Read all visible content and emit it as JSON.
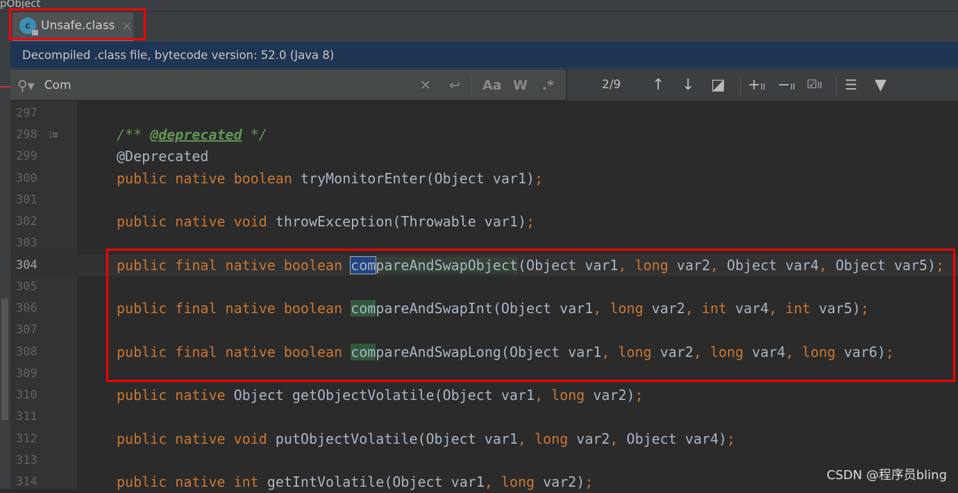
{
  "topbar": {
    "title": "pObject"
  },
  "tab": {
    "label": "Unsafe.class",
    "icon": "class-file-icon",
    "close": "×"
  },
  "banner": {
    "text": "Decompiled .class file, bytecode version: 52.0 (Java 8)"
  },
  "search": {
    "value": "Com",
    "count": "2/9",
    "icons": [
      "search-icon",
      "clear-icon",
      "new-line-icon",
      "match-case-icon",
      "words-icon",
      "regex-icon",
      "prev-occurrence-icon",
      "next-occurrence-icon",
      "select-all-icon",
      "add-selection-icon",
      "remove-selection-icon",
      "select-all-occurrences-icon",
      "filter-search-icon",
      "filter-icon"
    ],
    "labels": {
      "clear": "✕",
      "newline": "↩",
      "case": "Aa",
      "words": "W",
      "regex": ".*",
      "up": "↑",
      "down": "↓"
    }
  },
  "editor": {
    "caret_line": "304",
    "lines": [
      {
        "n": "297",
        "tokens": []
      },
      {
        "n": "298",
        "fold": true,
        "tokens": [
          {
            "c": "cm",
            "v": "/** "
          },
          {
            "c": "tag",
            "v": "@deprecated"
          },
          {
            "c": "cm",
            "v": " */"
          }
        ]
      },
      {
        "n": "299",
        "tokens": [
          {
            "c": "id",
            "v": "@Deprecated"
          }
        ]
      },
      {
        "n": "300",
        "tokens": [
          {
            "c": "kw",
            "v": "public native boolean "
          },
          {
            "c": "id",
            "v": "tryMonitorEnter(Object var1)"
          },
          {
            "c": "kw",
            "v": ";"
          }
        ]
      },
      {
        "n": "301",
        "tokens": []
      },
      {
        "n": "302",
        "tokens": [
          {
            "c": "kw",
            "v": "public native void "
          },
          {
            "c": "id",
            "v": "throwException(Throwable var1)"
          },
          {
            "c": "kw",
            "v": ";"
          }
        ]
      },
      {
        "n": "303",
        "tokens": []
      },
      {
        "n": "304",
        "tokens": [
          {
            "c": "kw",
            "v": "public final native boolean "
          },
          {
            "c": "cur",
            "v": "com"
          },
          {
            "c": "word",
            "v": "pareAndSwapObject"
          },
          {
            "c": "id",
            "v": "(Object var1"
          },
          {
            "c": "kw",
            "v": ", long "
          },
          {
            "c": "id",
            "v": "var2"
          },
          {
            "c": "kw",
            "v": ", "
          },
          {
            "c": "id",
            "v": "Object var4"
          },
          {
            "c": "kw",
            "v": ", "
          },
          {
            "c": "id",
            "v": "Object var5)"
          },
          {
            "c": "kw",
            "v": ";"
          }
        ]
      },
      {
        "n": "305",
        "tokens": []
      },
      {
        "n": "306",
        "tokens": [
          {
            "c": "kw",
            "v": "public final native boolean "
          },
          {
            "c": "match",
            "v": "com"
          },
          {
            "c": "id",
            "v": "pareAndSwapInt(Object var1"
          },
          {
            "c": "kw",
            "v": ", long "
          },
          {
            "c": "id",
            "v": "var2"
          },
          {
            "c": "kw",
            "v": ", int "
          },
          {
            "c": "id",
            "v": "var4"
          },
          {
            "c": "kw",
            "v": ", int "
          },
          {
            "c": "id",
            "v": "var5)"
          },
          {
            "c": "kw",
            "v": ";"
          }
        ]
      },
      {
        "n": "307",
        "tokens": []
      },
      {
        "n": "308",
        "tokens": [
          {
            "c": "kw",
            "v": "public final native boolean "
          },
          {
            "c": "match",
            "v": "com"
          },
          {
            "c": "id",
            "v": "pareAndSwapLong(Object var1"
          },
          {
            "c": "kw",
            "v": ", long "
          },
          {
            "c": "id",
            "v": "var2"
          },
          {
            "c": "kw",
            "v": ", long "
          },
          {
            "c": "id",
            "v": "var4"
          },
          {
            "c": "kw",
            "v": ", long "
          },
          {
            "c": "id",
            "v": "var6)"
          },
          {
            "c": "kw",
            "v": ";"
          }
        ]
      },
      {
        "n": "309",
        "tokens": []
      },
      {
        "n": "310",
        "tokens": [
          {
            "c": "kw",
            "v": "public native "
          },
          {
            "c": "id",
            "v": "Object getObjectVolatile(Object var1"
          },
          {
            "c": "kw",
            "v": ", long "
          },
          {
            "c": "id",
            "v": "var2)"
          },
          {
            "c": "kw",
            "v": ";"
          }
        ]
      },
      {
        "n": "311",
        "tokens": []
      },
      {
        "n": "312",
        "tokens": [
          {
            "c": "kw",
            "v": "public native void "
          },
          {
            "c": "id",
            "v": "putObjectVolatile(Object var1"
          },
          {
            "c": "kw",
            "v": ", long "
          },
          {
            "c": "id",
            "v": "var2"
          },
          {
            "c": "kw",
            "v": ", "
          },
          {
            "c": "id",
            "v": "Object var4)"
          },
          {
            "c": "kw",
            "v": ";"
          }
        ]
      },
      {
        "n": "313",
        "tokens": []
      },
      {
        "n": "314",
        "tokens": [
          {
            "c": "kw",
            "v": "public native int "
          },
          {
            "c": "id",
            "v": "getIntVolatile(Object var1"
          },
          {
            "c": "kw",
            "v": ", long "
          },
          {
            "c": "id",
            "v": "var2)"
          },
          {
            "c": "kw",
            "v": ";"
          }
        ]
      }
    ]
  },
  "watermark": "CSDN @程序员bling",
  "colors": {
    "keyword": "#cc7832",
    "identifier": "#a9b7c6",
    "comment": "#629755",
    "annotation_box": "#ff0000",
    "current_match": "#214283",
    "match": "#32593d"
  }
}
